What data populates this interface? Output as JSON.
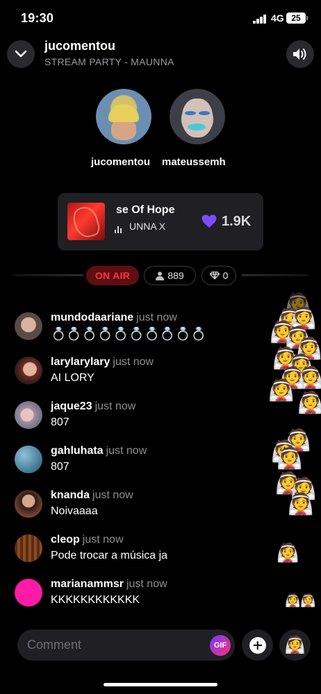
{
  "status_bar": {
    "time": "19:30",
    "network": "4G",
    "battery": "25"
  },
  "header": {
    "title": "jucomentou",
    "subtitle": "STREAM PARTY - MAUNNA",
    "collapse_icon": "chevron-down-icon",
    "sound_icon": "speaker-icon"
  },
  "hosts": [
    {
      "name": "jucomentou"
    },
    {
      "name": "mateussemh"
    }
  ],
  "now_playing": {
    "title_visible": "se Of Hope",
    "artist": "UNNA X",
    "likes": "1.9K",
    "like_color": "#7b4dff"
  },
  "live": {
    "status": "ON AIR",
    "viewers": "889",
    "gems": "0"
  },
  "comments": [
    {
      "user": "mundodaariane",
      "time": "just now",
      "text": "💍💍💍💍💍💍💍💍💍💍",
      "avatar_color": "#8a7b72"
    },
    {
      "user": "larylarylary",
      "time": "just now",
      "text": "AI LORY",
      "avatar_color": "#6d4438"
    },
    {
      "user": "jaque23",
      "time": "just now",
      "text": "807",
      "avatar_color": "#b7a5b1"
    },
    {
      "user": "gahluhata",
      "time": "just now",
      "text": "807",
      "avatar_color": "#4f8aa8"
    },
    {
      "user": "knanda",
      "time": "just now",
      "text": "Noivaaaa",
      "avatar_color": "#5b3a32"
    },
    {
      "user": "cleop",
      "time": "just now",
      "text": "Pode trocar a música ja",
      "avatar_color": "#6b3a1e"
    },
    {
      "user": "marianammsr",
      "time": "just now",
      "text": "KKKKKKKKKKKK",
      "avatar_color": "#ff1aa8"
    }
  ],
  "reaction_emoji": "👰",
  "reaction_emoji_pair": "👰👰",
  "composer": {
    "placeholder": "Comment",
    "gif_label": "GIF",
    "add_icon": "plus-circle-icon",
    "reaction_button_emoji": "👰"
  },
  "colors": {
    "on_air_bg": "#5f0e12",
    "on_air_text": "#ff3342",
    "gif_gradient": [
      "#6f3cff",
      "#ff2d7a"
    ]
  }
}
